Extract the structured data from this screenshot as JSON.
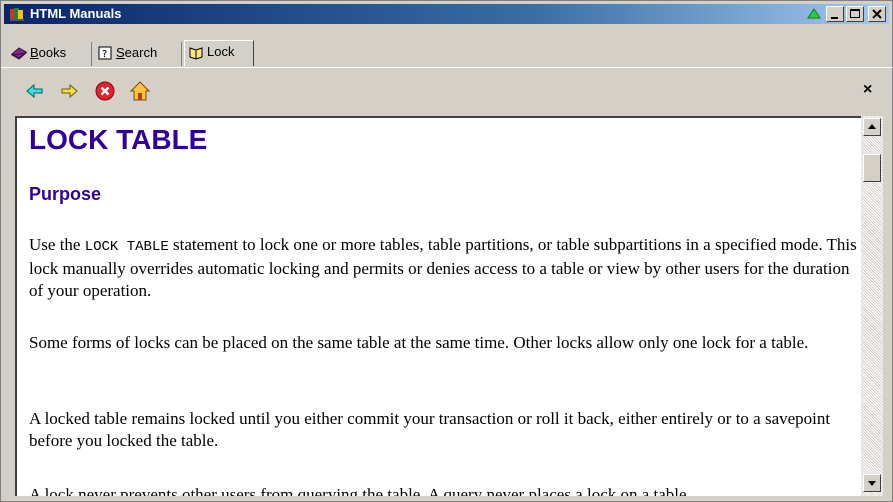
{
  "window": {
    "title": "HTML Manuals"
  },
  "tabs": [
    {
      "prefix": "",
      "accel": "B",
      "rest": "ooks",
      "icon": "books-icon"
    },
    {
      "prefix": "",
      "accel": "S",
      "rest": "earch",
      "icon": "search-help-icon"
    },
    {
      "prefix": "",
      "accel": "",
      "rest": "Lock",
      "icon": "open-book-icon"
    }
  ],
  "toolbar": {
    "back_icon": "back-arrow-icon",
    "forward_icon": "forward-arrow-icon",
    "stop_icon": "stop-icon",
    "home_icon": "home-icon",
    "close_label": "×"
  },
  "content": {
    "heading": "LOCK TABLE",
    "subheading": "Purpose",
    "p1_before": "Use the ",
    "p1_code": "LOCK TABLE",
    "p1_after": " statement to lock one or more tables, table partitions, or table subpartitions in a specified mode. This lock manually overrides automatic locking and permits or denies access to a table or view by other users for the duration of your operation.",
    "p2": "Some forms of locks can be placed on the same table at the same time. Other locks allow only one lock for a table.",
    "p3": "A locked table remains locked until you either commit your transaction or roll it back, either entirely or to a savepoint before you locked the table.",
    "p4": "A lock never prevents other users from querying the table. A query never places a lock on a table."
  },
  "colors": {
    "heading": "#330099",
    "titlebar_start": "#0a246a",
    "titlebar_end": "#a6caf0"
  }
}
